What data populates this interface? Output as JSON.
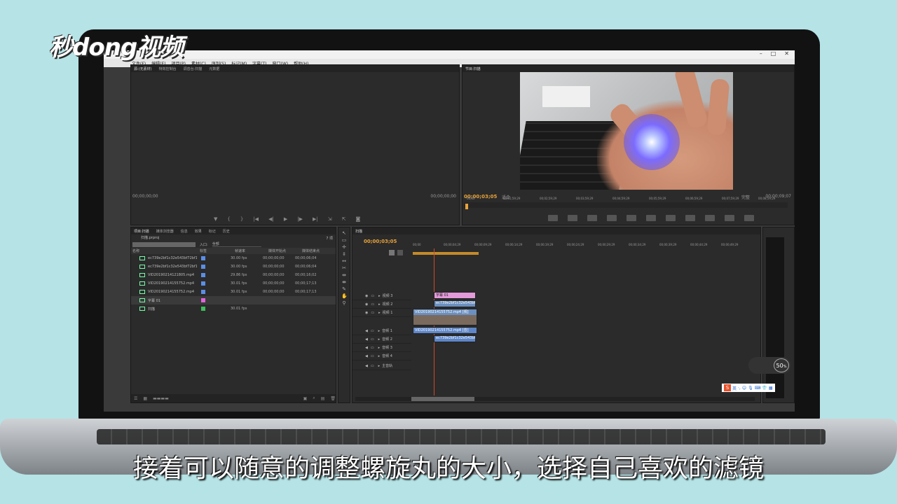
{
  "logo": {
    "text": "秒dong视频"
  },
  "caption": "接着可以随意的调整螺旋丸的大小，选择自己喜欢的滤镜",
  "menu": [
    "文件(F)",
    "编辑(E)",
    "项目(P)",
    "素材(C)",
    "序列(S)",
    "标记(M)",
    "字幕(T)",
    "窗口(W)",
    "帮助(H)"
  ],
  "source_panel": {
    "tabs": [
      "源:(无素材)",
      "特效控制台",
      "调音台:扫描",
      "元数据"
    ],
    "timecode_left": "00;00;00;00",
    "timecode_right": "00;00;00;00"
  },
  "program_panel": {
    "tab": "节目:扫描",
    "timecode_left": "00;00;03;05",
    "fit": "适合",
    "quality": "完整",
    "timecode_right": "00;00;09;07",
    "ruler": [
      "00;00",
      "00;01;59;29",
      "00;02;59;29",
      "00;03;59;29",
      "00;04;59;29",
      "00;05;59;29",
      "00;06;59;29",
      "00;07;59;29",
      "00;08;59;29"
    ]
  },
  "project_panel": {
    "tabs": [
      "项目:扫描",
      "媒体浏览器",
      "信息",
      "效果",
      "标记",
      "历史"
    ],
    "project_name": "扫描.prproj",
    "item_count": "7 项",
    "entry_label": "入口:",
    "entry_value": "全部",
    "columns": [
      "名称",
      "标签",
      "帧速率",
      "媒体开始点",
      "媒体结束点"
    ],
    "items": [
      {
        "name": "ec739e2bf1c32e543bf72bf1",
        "color": "#5b8ee6",
        "fps": "30.00 fps",
        "start": "00;00;00;00",
        "end": "00;00;06;04"
      },
      {
        "name": "ec739e2bf1c32e543bf72bf1",
        "color": "#5b8ee6",
        "fps": "30.00 fps",
        "start": "00;00;00;00",
        "end": "00;00;06;04"
      },
      {
        "name": "VID20190214121805.mp4",
        "color": "#5b8ee6",
        "fps": "29.86 fps",
        "start": "00;00;00;00",
        "end": "00;00;16;02"
      },
      {
        "name": "VID20190214155752.mp4",
        "color": "#5b8ee6",
        "fps": "30.01 fps",
        "start": "00;00;00;00",
        "end": "00;00;17;13"
      },
      {
        "name": "VID20190214155752.mp4",
        "color": "#5b8ee6",
        "fps": "30.01 fps",
        "start": "00;00;00;00",
        "end": "00;00;17;13"
      },
      {
        "name": "字幕 01",
        "color": "#e066d9",
        "fps": "",
        "start": "",
        "end": ""
      },
      {
        "name": "扫描",
        "color": "#3fbf5a",
        "fps": "30.01 fps",
        "start": "",
        "end": ""
      }
    ]
  },
  "timeline": {
    "tab": "扫描",
    "timecode": "00;00;03;05",
    "ruler": [
      "00;00",
      "00;00;04;29",
      "00;00;09;29",
      "00;00;14;29",
      "00;00;19;29",
      "00;00;24;29",
      "00;00;29;29",
      "00;00;34;29",
      "00;00;39;29",
      "00;00;44;29",
      "00;00;49;29"
    ],
    "tracks": [
      "视频 3",
      "视频 2",
      "视频 1",
      "音频 1",
      "音频 2",
      "音频 3",
      "音频 4",
      "主音轨"
    ],
    "clips": {
      "title": "字幕 01",
      "v2": "ec739e2bf1c32e543bf7",
      "v1": "VID20190214155752.mp4 [视]",
      "a1": "VID20190214155752.mp4 [音]",
      "a2": "ec739e2bf1c32e543bf7"
    }
  },
  "widget": {
    "value": "50",
    "unit": "%"
  },
  "ime": {
    "label": "英"
  },
  "colors": {
    "accent": "#e8a33a",
    "clip_video": "#6b8fbf",
    "clip_title": "#e29ad9",
    "clip_audio": "#5e86c8"
  }
}
